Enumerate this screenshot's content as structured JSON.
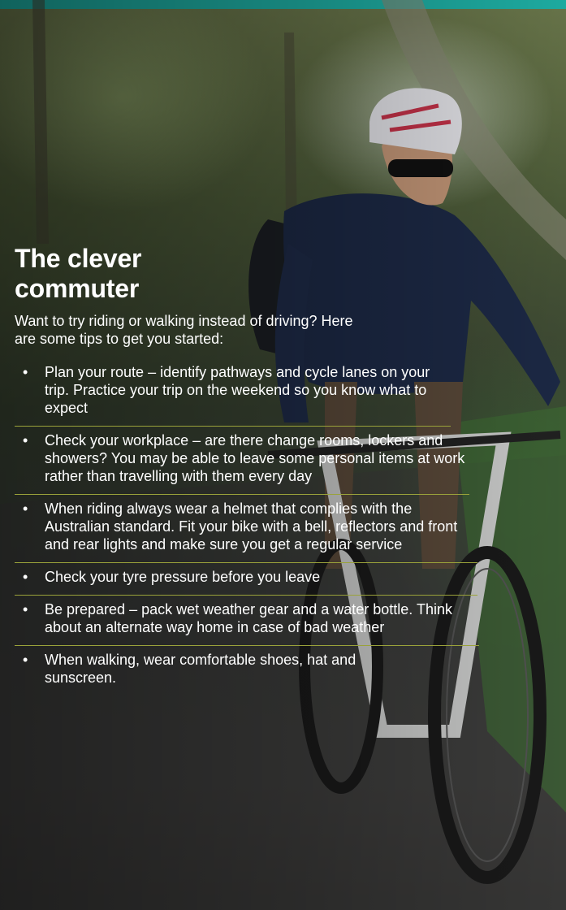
{
  "article": {
    "title": "The clever commuter",
    "intro": "Want to try riding or walking instead of driving? Here are some tips to get you started:",
    "bullet_symbol": "•",
    "tips": [
      "Plan your route – identify pathways and cycle lanes on your trip. Practice your trip on the weekend so you know what to expect",
      "Check your workplace – are there change rooms, lockers and showers? You may be able to leave some personal items at work rather than travelling with them every day",
      "When riding always wear a helmet that complies with the Australian standard. Fit your bike with a bell, reflectors and front and rear lights and make sure you get a regular service",
      "Check your tyre pressure before you leave",
      "Be prepared – pack wet weather gear and a water bottle. Think about an alternate way home in case of bad weather",
      "When walking, wear comfortable shoes, hat and sunscreen."
    ]
  },
  "colors": {
    "accent_bar": "#1fb3a8",
    "divider": "#9aa23a",
    "text": "#ffffff"
  }
}
